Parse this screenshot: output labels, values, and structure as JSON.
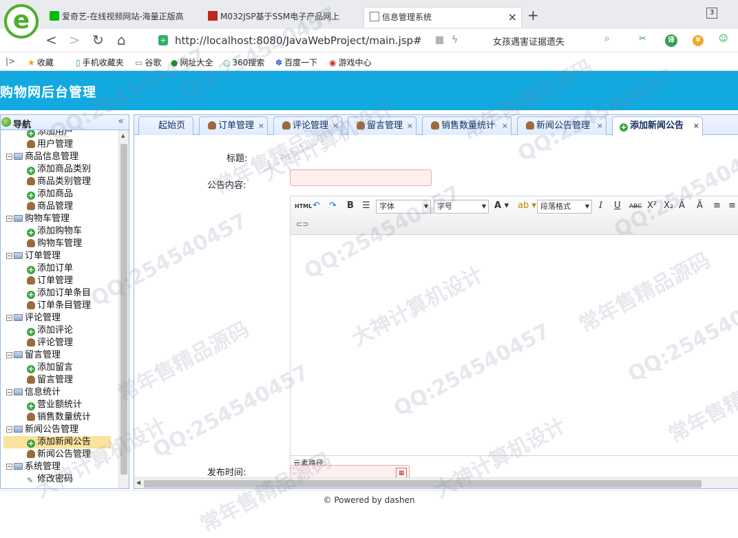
{
  "browser": {
    "tabs": [
      {
        "label": "爱奇艺-在线视频网站-海量正版高"
      },
      {
        "label": "M032JSP基于SSM电子产品网上"
      },
      {
        "label": "信息管理系统"
      }
    ],
    "tab_count": "3",
    "url": "http://localhost:8080/JavaWebProject/main.jsp#",
    "search_text": "女孩遇害证据遗失",
    "bookmarks": [
      {
        "label": "收藏",
        "icon": "star-icon"
      },
      {
        "label": "手机收藏夹",
        "icon": "phone-icon"
      },
      {
        "label": "谷歌",
        "icon": "page-icon"
      },
      {
        "label": "网址大全",
        "icon": "globe-icon"
      },
      {
        "label": "360搜索",
        "icon": "search-360-icon"
      },
      {
        "label": "百度一下",
        "icon": "baidu-icon"
      },
      {
        "label": "游戏中心",
        "icon": "game-icon"
      }
    ]
  },
  "app": {
    "title": "购物网后台管理"
  },
  "sidebar": {
    "title": "导航",
    "items": [
      {
        "label": "添加用户",
        "icon": "add",
        "level": 2
      },
      {
        "label": "用户管理",
        "icon": "user",
        "level": 2
      },
      {
        "label": "商品信息管理",
        "icon": "folder",
        "level": 1
      },
      {
        "label": "添加商品类别",
        "icon": "add",
        "level": 2
      },
      {
        "label": "商品类别管理",
        "icon": "user",
        "level": 2
      },
      {
        "label": "添加商品",
        "icon": "add",
        "level": 2
      },
      {
        "label": "商品管理",
        "icon": "user",
        "level": 2
      },
      {
        "label": "购物车管理",
        "icon": "folder",
        "level": 1
      },
      {
        "label": "添加购物车",
        "icon": "add",
        "level": 2
      },
      {
        "label": "购物车管理",
        "icon": "user",
        "level": 2
      },
      {
        "label": "订单管理",
        "icon": "folder",
        "level": 1
      },
      {
        "label": "添加订单",
        "icon": "add",
        "level": 2
      },
      {
        "label": "订单管理",
        "icon": "user",
        "level": 2
      },
      {
        "label": "添加订单条目",
        "icon": "add",
        "level": 2
      },
      {
        "label": "订单条目管理",
        "icon": "user",
        "level": 2
      },
      {
        "label": "评论管理",
        "icon": "folder",
        "level": 1
      },
      {
        "label": "添加评论",
        "icon": "add",
        "level": 2
      },
      {
        "label": "评论管理",
        "icon": "user",
        "level": 2
      },
      {
        "label": "留言管理",
        "icon": "folder",
        "level": 1
      },
      {
        "label": "添加留言",
        "icon": "add",
        "level": 2
      },
      {
        "label": "留言管理",
        "icon": "user",
        "level": 2
      },
      {
        "label": "信息统计",
        "icon": "folder",
        "level": 1
      },
      {
        "label": "营业额统计",
        "icon": "add",
        "level": 2
      },
      {
        "label": "销售数量统计",
        "icon": "user",
        "level": 2
      },
      {
        "label": "新闻公告管理",
        "icon": "folder",
        "level": 1
      },
      {
        "label": "添加新闻公告",
        "icon": "add",
        "level": 2,
        "selected": true
      },
      {
        "label": "新闻公告管理",
        "icon": "user",
        "level": 2
      },
      {
        "label": "系统管理",
        "icon": "folder",
        "level": 1
      },
      {
        "label": "修改密码",
        "icon": "pen",
        "level": 2
      }
    ]
  },
  "page_tabs": [
    {
      "label": "起始页",
      "icon": "",
      "closable": false
    },
    {
      "label": "订单管理",
      "icon": "user",
      "closable": true
    },
    {
      "label": "评论管理",
      "icon": "user",
      "closable": true
    },
    {
      "label": "留言管理",
      "icon": "user",
      "closable": true
    },
    {
      "label": "销售数量统计",
      "icon": "user",
      "closable": true
    },
    {
      "label": "新闻公告管理",
      "icon": "user",
      "closable": true
    },
    {
      "label": "添加新闻公告",
      "icon": "add",
      "closable": true,
      "active": true
    }
  ],
  "form": {
    "title_label": "标题:",
    "content_label": "公告内容:",
    "date_label": "发布时间:",
    "title_value": "",
    "date_value": ""
  },
  "editor": {
    "html_btn": "HTML",
    "font_select": "字体",
    "size_select": "字号",
    "paragraph_select": "段落格式",
    "element_path": "元素路径:"
  },
  "footer": {
    "text": "© Powered by dashen"
  },
  "watermark": {
    "texts": [
      "QQ:254540457",
      "大神计算机设计",
      "常年售精品源码"
    ]
  },
  "colors": {
    "header_bg": "#12a9e0",
    "selected_item": "#fbe39f",
    "panel_border": "#95b8e7"
  }
}
